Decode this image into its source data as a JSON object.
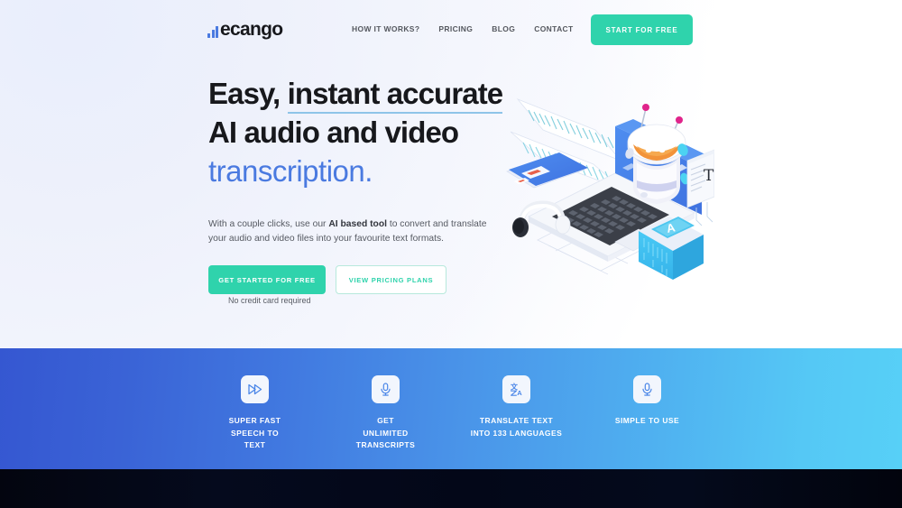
{
  "brand": {
    "name": "ecango",
    "logo_icon": "bar-chart-logo-icon",
    "logo_color": "#4a7ae0"
  },
  "nav": {
    "links": [
      {
        "label": "HOW IT WORKS?",
        "name": "nav-link-how-it-works"
      },
      {
        "label": "PRICING",
        "name": "nav-link-pricing"
      },
      {
        "label": "BLOG",
        "name": "nav-link-blog"
      },
      {
        "label": "CONTACT",
        "name": "nav-link-contact"
      }
    ],
    "cta_label": "START FOR FREE",
    "cta_color": "#2fd3ac"
  },
  "hero": {
    "headline": {
      "line1_plain": "Easy, ",
      "line1_underlined": "instant accurate",
      "line2": "AI audio and video",
      "line3_accent": "transcription.",
      "underline_color": "#8ec4e8",
      "accent_color": "#4a7ae0"
    },
    "subcopy": {
      "part1": "With a couple clicks, use our ",
      "bold": "AI based tool",
      "part2": " to convert and translate your audio and video files into your favourite text formats."
    },
    "primary_button": "GET STARTED FOR FREE",
    "secondary_button": "VIEW PRICING PLANS",
    "note": "No credit card required",
    "illustration_name": "ai-transcription-isometric-illustration"
  },
  "features": {
    "gradient_from": "#3557d1",
    "gradient_to": "#57d0f7",
    "items": [
      {
        "icon": "fast-forward-icon",
        "label": "SUPER FAST\nSPEECH TO\nTEXT",
        "name": "feature-super-fast-speech-to-text"
      },
      {
        "icon": "microphone-icon",
        "label": "GET\nUNLIMITED\nTRANSCRIPTS",
        "name": "feature-get-unlimited-transcripts"
      },
      {
        "icon": "translate-icon",
        "label": "TRANSLATE TEXT\nINTO 133 LANGUAGES",
        "name": "feature-translate-text"
      },
      {
        "icon": "microphone-icon",
        "label": "SIMPLE TO USE",
        "name": "feature-simple-to-use"
      }
    ]
  },
  "footer": {
    "background_color": "#03050f"
  }
}
